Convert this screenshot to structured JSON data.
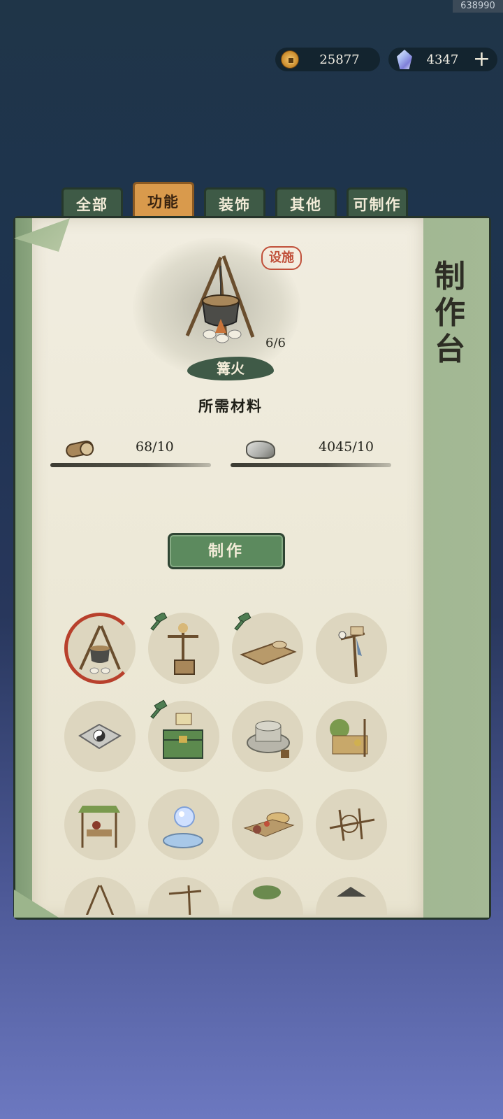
{
  "corner_id": "638990",
  "currency": {
    "coins": "25877",
    "gems": "4347",
    "plus_label": "+"
  },
  "tabs": [
    {
      "label": "全部"
    },
    {
      "label": "功能"
    },
    {
      "label": "装饰"
    },
    {
      "label": "其他"
    },
    {
      "label": "可制作"
    }
  ],
  "active_tab": "功能",
  "side_title": "制作台",
  "selected_item": {
    "name": "篝火",
    "seal": "设施",
    "stock": "6/6",
    "icon": "campfire-pot-icon"
  },
  "requirements": {
    "title": "所需材料",
    "materials": [
      {
        "icon": "wood-log-icon",
        "count": "68/10"
      },
      {
        "icon": "stone-icon",
        "count": "4045/10"
      }
    ]
  },
  "make_button": "制作",
  "grid_items": [
    {
      "icon": "campfire-icon",
      "selected": true,
      "hammer": false
    },
    {
      "icon": "scarecrow-icon",
      "selected": false,
      "hammer": true
    },
    {
      "icon": "drying-rack-icon",
      "selected": false,
      "hammer": true
    },
    {
      "icon": "weathervane-post-icon",
      "selected": false,
      "hammer": false
    },
    {
      "icon": "bagua-altar-icon",
      "selected": false,
      "hammer": false
    },
    {
      "icon": "storage-chest-icon",
      "selected": false,
      "hammer": true
    },
    {
      "icon": "millstone-icon",
      "selected": false,
      "hammer": false
    },
    {
      "icon": "garden-shelf-icon",
      "selected": false,
      "hammer": false
    },
    {
      "icon": "market-stall-icon",
      "selected": false,
      "hammer": false
    },
    {
      "icon": "crystal-orb-fountain-icon",
      "selected": false,
      "hammer": false
    },
    {
      "icon": "cooking-table-icon",
      "selected": false,
      "hammer": false
    },
    {
      "icon": "spinning-wheel-icon",
      "selected": false,
      "hammer": false
    },
    {
      "icon": "tripod-frame-icon",
      "selected": false,
      "hammer": false
    },
    {
      "icon": "wooden-frame-icon",
      "selected": false,
      "hammer": false
    },
    {
      "icon": "tree-planter-icon",
      "selected": false,
      "hammer": false
    },
    {
      "icon": "hut-roof-icon",
      "selected": false,
      "hammer": false
    }
  ]
}
